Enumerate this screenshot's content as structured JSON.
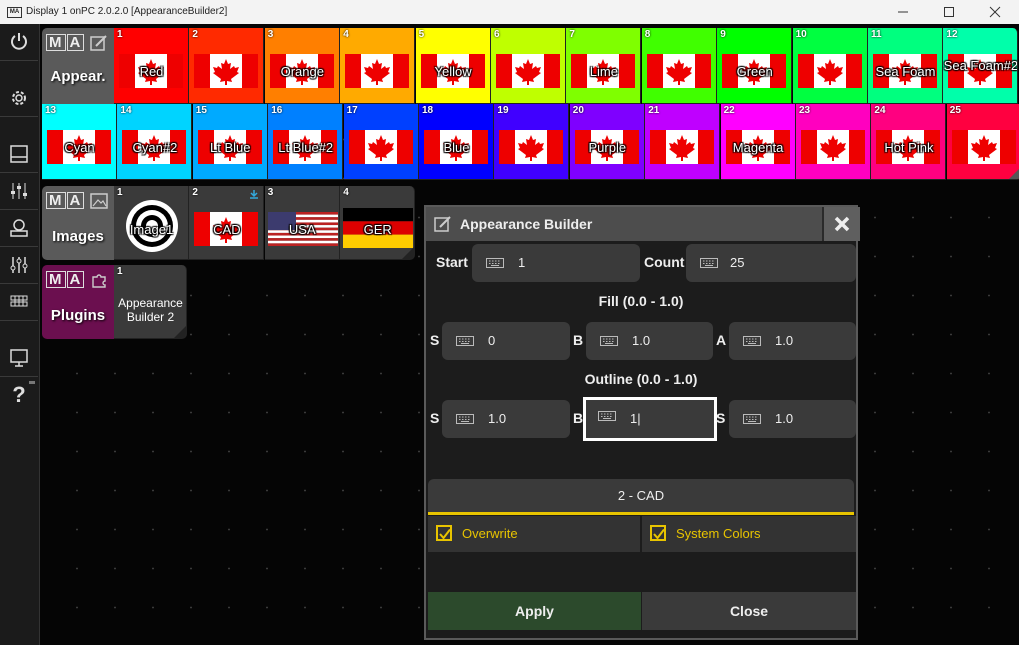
{
  "window": {
    "title": "Display 1 onPC 2.0.2.0 [AppearanceBuilder2]",
    "app_icon_text": "MA"
  },
  "sidebar": {
    "buttons": [
      {
        "name": "power-icon"
      },
      {
        "name": "gear-icon"
      },
      {
        "name": "view-icon"
      },
      {
        "name": "faders-icon"
      },
      {
        "name": "user-icon"
      },
      {
        "name": "sliders-icon"
      },
      {
        "name": "grid-icon"
      },
      {
        "name": "monitor-icon"
      },
      {
        "name": "help-icon",
        "label": "?"
      }
    ]
  },
  "pools": {
    "appearances": {
      "ma": "MA",
      "label": "Appear.",
      "header_color": "#5a5a5a",
      "items": [
        {
          "num": "1",
          "label": "Red",
          "color": "#ff0000"
        },
        {
          "num": "2",
          "label": "",
          "color": "#ff2a00"
        },
        {
          "num": "3",
          "label": "Orange",
          "color": "#ff7f00"
        },
        {
          "num": "4",
          "label": "",
          "color": "#ffaa00"
        },
        {
          "num": "5",
          "label": "Yellow",
          "color": "#ffff00"
        },
        {
          "num": "6",
          "label": "",
          "color": "#bfff00"
        },
        {
          "num": "7",
          "label": "Lime",
          "color": "#7fff00"
        },
        {
          "num": "8",
          "label": "",
          "color": "#40ff00"
        },
        {
          "num": "9",
          "label": "Green",
          "color": "#00ff00"
        },
        {
          "num": "10",
          "label": "",
          "color": "#00ff40"
        },
        {
          "num": "11",
          "label": "Sea Foam",
          "color": "#00ff7f"
        },
        {
          "num": "12",
          "label": "Sea Foam#2",
          "color": "#00ffaa"
        },
        {
          "num": "13",
          "label": "Cyan",
          "color": "#00ffff"
        },
        {
          "num": "14",
          "label": "Cyan#2",
          "color": "#00d4ff"
        },
        {
          "num": "15",
          "label": "Lt Blue",
          "color": "#00aaff"
        },
        {
          "num": "16",
          "label": "Lt Blue#2",
          "color": "#0080ff"
        },
        {
          "num": "17",
          "label": "",
          "color": "#0040ff"
        },
        {
          "num": "18",
          "label": "Blue",
          "color": "#0000ff"
        },
        {
          "num": "19",
          "label": "",
          "color": "#4000ff"
        },
        {
          "num": "20",
          "label": "Purple",
          "color": "#7f00ff"
        },
        {
          "num": "21",
          "label": "",
          "color": "#bf00ff"
        },
        {
          "num": "22",
          "label": "Magenta",
          "color": "#ff00ff"
        },
        {
          "num": "23",
          "label": "",
          "color": "#ff00bf"
        },
        {
          "num": "24",
          "label": "Hot Pink",
          "color": "#ff0080"
        },
        {
          "num": "25",
          "label": "",
          "color": "#ff0040"
        }
      ]
    },
    "images": {
      "ma": "MA",
      "label": "Images",
      "items": [
        {
          "num": "1",
          "label": "Image1",
          "kind": "target"
        },
        {
          "num": "2",
          "label": "CAD",
          "kind": "canada"
        },
        {
          "num": "3",
          "label": "USA",
          "kind": "usa"
        },
        {
          "num": "4",
          "label": "GER",
          "kind": "germany"
        }
      ]
    },
    "plugins": {
      "ma": "MA",
      "label": "Plugins",
      "header_color": "#6b0f4f",
      "items": [
        {
          "num": "1",
          "label": "Appearance Builder 2"
        }
      ]
    }
  },
  "dialog": {
    "title": "Appearance Builder",
    "start_label": "Start",
    "start_value": "1",
    "count_label": "Count",
    "count_value": "25",
    "fill_title": "Fill (0.0 - 1.0)",
    "fill": [
      {
        "label": "S",
        "value": "0"
      },
      {
        "label": "B",
        "value": "1.0"
      },
      {
        "label": "A",
        "value": "1.0"
      }
    ],
    "outline_title": "Outline (0.0 - 1.0)",
    "outline": [
      {
        "label": "S",
        "value": "1.0"
      },
      {
        "label": "B",
        "value": "1|"
      },
      {
        "label": "S",
        "value": "1.0"
      }
    ],
    "selected_image": "2 - CAD",
    "overwrite_label": "Overwrite",
    "system_colors_label": "System Colors",
    "apply_label": "Apply",
    "close_label": "Close",
    "accent_color": "#e8c400"
  }
}
